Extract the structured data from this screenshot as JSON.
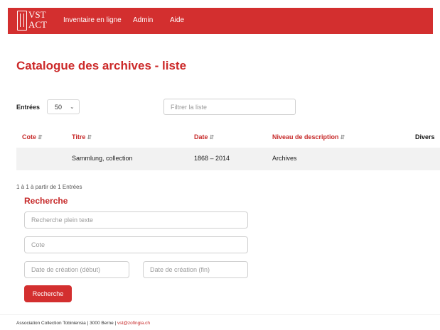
{
  "nav": {
    "logo_text_line1": "VST",
    "logo_text_line2": "ACT",
    "links": [
      "Inventaire en ligne",
      "Admin",
      "Aide"
    ]
  },
  "page": {
    "title": "Catalogue des archives - liste"
  },
  "controls": {
    "entries_label": "Entrées",
    "entries_value": "50",
    "filter_placeholder": "Filtrer la liste"
  },
  "table": {
    "headers": [
      "Cote",
      "Titre",
      "Date",
      "Niveau de description",
      "Divers"
    ],
    "rows": [
      {
        "cote": "",
        "titre": "Sammlung, collection",
        "date": "1868 – 2014",
        "niveau": "Archives",
        "divers": ""
      }
    ],
    "info": "1 à 1 à partir de 1 Entrées"
  },
  "search": {
    "title": "Recherche",
    "fulltext_placeholder": "Recherche plein texte",
    "cote_placeholder": "Cote",
    "date_start_placeholder": "Date de création (début)",
    "date_end_placeholder": "Date de création (fin)",
    "button_label": "Recherche"
  },
  "footer": {
    "text": "Association Collection Tobiniensia | 3000 Berne | ",
    "email": "vst@zofingia.ch"
  },
  "colors": {
    "brand_red": "#d32f2f",
    "accent_red": "#c62828",
    "row_background": "#f2f2f2"
  },
  "icons": {
    "sort": "sort-icon",
    "select_chevron": "chevron-down-icon",
    "logo": "vst-act-logo"
  }
}
